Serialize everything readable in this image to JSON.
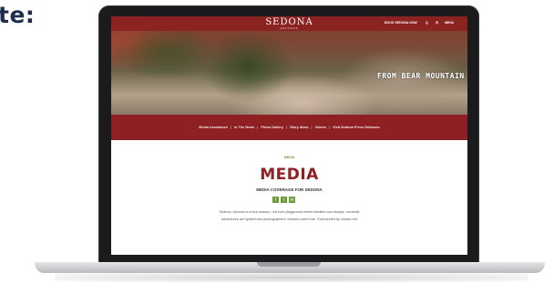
{
  "heading": "te:",
  "site": {
    "logo": "SEDONA",
    "logo_sub": "ARIZONA",
    "top_links": [
      "BOOK SEDONA NOW",
      "Q",
      "☰",
      "MENU"
    ],
    "hero_caption": "FROM BEAR MOUNTAIN",
    "nav": [
      "Media Assistance",
      "In The News",
      "Photo Gallery",
      "Story Ideas",
      "Videos",
      "Visit Sedona Press Releases"
    ],
    "eyebrow": "MEDIA",
    "title": "MEDIA",
    "subtitle": "MEDIA COVERAGE FOR SEDONA",
    "social_icons": [
      "facebook-icon",
      "twitter-icon",
      "email-icon"
    ],
    "body_line1": "Sedona, Arizona is a four-season, red rock playground where families can escape, romantic",
    "body_line2": "adventures are ignited and photographers' dreams come true. Surrounded by vibrant red"
  },
  "colors": {
    "brand_red": "#8e1f23",
    "accent_green": "#6f9a3a",
    "heading_navy": "#1f2d4d"
  }
}
